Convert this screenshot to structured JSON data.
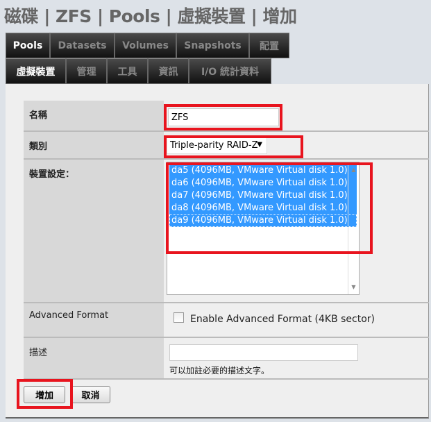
{
  "breadcrumb": "磁碟 | ZFS | Pools | 虛擬裝置 | 增加",
  "tabs_primary": [
    {
      "label": "Pools",
      "active": true
    },
    {
      "label": "Datasets"
    },
    {
      "label": "Volumes"
    },
    {
      "label": "Snapshots"
    },
    {
      "label": "配置"
    }
  ],
  "tabs_secondary": [
    {
      "label": "虛擬裝置",
      "active": true
    },
    {
      "label": "管理"
    },
    {
      "label": "工具"
    },
    {
      "label": "資訊"
    },
    {
      "label": "I/O 統計資料"
    }
  ],
  "form": {
    "name_label": "名稱",
    "name_value": "ZFS",
    "type_label": "類別",
    "type_value": "Triple-parity RAID-Z",
    "devices_label": "裝置設定：",
    "devices": [
      "da5 (4096MB, VMware Virtual disk 1.0)",
      "da6 (4096MB, VMware Virtual disk 1.0)",
      "da7 (4096MB, VMware Virtual disk 1.0)",
      "da8 (4096MB, VMware Virtual disk 1.0)",
      "da9 (4096MB, VMware Virtual disk 1.0)"
    ],
    "af_label": "Advanced Format",
    "af_checkbox_label": "Enable Advanced Format (4KB sector)",
    "af_checked": false,
    "desc_label": "描述",
    "desc_value": "",
    "desc_hint": "可以加註必要的描述文字。"
  },
  "buttons": {
    "add": "增加",
    "cancel": "取消"
  },
  "colors": {
    "highlight": "#e8141e",
    "selection": "#3399ff"
  }
}
